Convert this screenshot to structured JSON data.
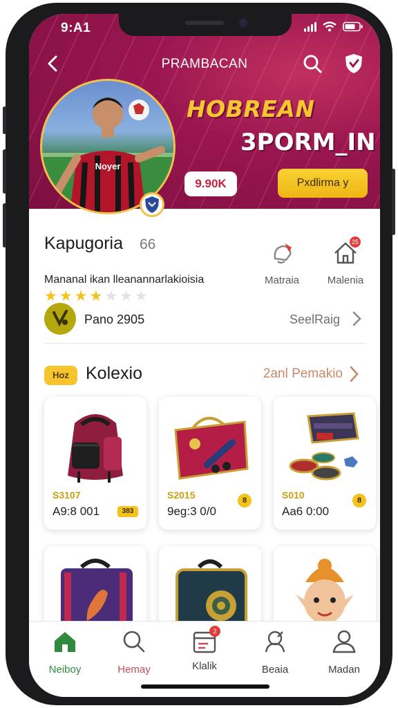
{
  "status_bar": {
    "time": "9:A1"
  },
  "top_bar": {
    "title": "PRAMBACAN"
  },
  "hero": {
    "title": "HOBREAN",
    "subtitle": "3PORM_IN",
    "price_badge": "9.90K",
    "cta_label": "Pxdlirma y",
    "jersey_text": "Noyer"
  },
  "product": {
    "name": "Kapugoria",
    "count": "66",
    "description": "Mananal ikan lleanannarlakioisia",
    "rating": 4,
    "rating_max": 7,
    "actions": [
      {
        "label": "Matraia",
        "icon": "bell-icon"
      },
      {
        "label": "Malenia",
        "icon": "home-icon",
        "badge": "25"
      }
    ]
  },
  "seller": {
    "name": "Pano 2905",
    "link_label": "SeelRaig"
  },
  "section": {
    "badge": "Hoz",
    "title": "Kolexio",
    "link_label": "2anl Pemakio"
  },
  "cards": [
    {
      "price": "S3107",
      "sub": "A9:8 001",
      "tag": "383"
    },
    {
      "price": "S2015",
      "sub": "9eg:3 0/0",
      "coin": "8"
    },
    {
      "price": "S010",
      "sub": "Aa6 0:00",
      "coin": "8"
    },
    {
      "price": "",
      "sub": ""
    },
    {
      "price": "",
      "sub": ""
    },
    {
      "price": "",
      "sub": ""
    }
  ],
  "tabs": [
    {
      "label": "Neiboy",
      "icon": "home-icon",
      "active": true
    },
    {
      "label": "Hemay",
      "icon": "search-icon"
    },
    {
      "label": "Klalik",
      "icon": "cart-icon",
      "badge": "2"
    },
    {
      "label": "Beaia",
      "icon": "chat-icon"
    },
    {
      "label": "Madan",
      "icon": "user-icon"
    }
  ],
  "colors": {
    "header": "#9a1650",
    "accent_yellow": "#f6c42c",
    "active_tab": "#2f8a3f",
    "badge_red": "#e03d3a"
  }
}
